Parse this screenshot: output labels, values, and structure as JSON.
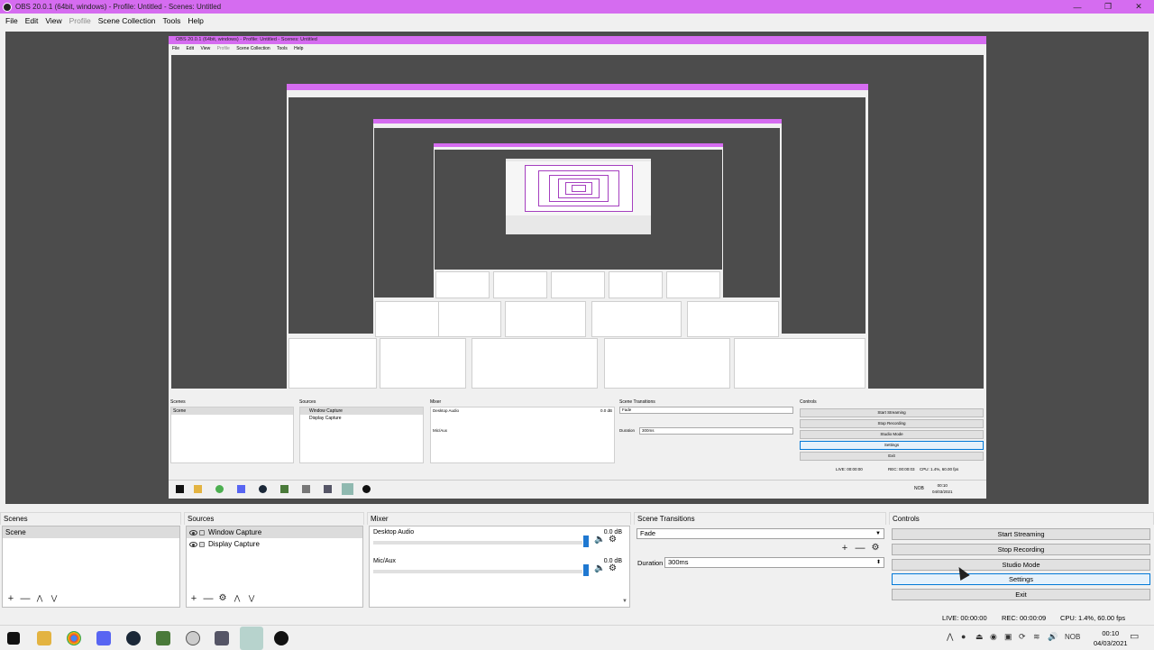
{
  "window": {
    "title": "OBS 20.0.1 (64bit, windows) - Profile: Untitled - Scenes: Untitled",
    "minimize": "—",
    "maximize": "❐",
    "close": "✕"
  },
  "menu": {
    "file": "File",
    "edit": "Edit",
    "view": "View",
    "profile": "Profile",
    "scene_collection": "Scene Collection",
    "tools": "Tools",
    "help": "Help"
  },
  "nested": {
    "title": "OBS 20.0.1 (64bit, windows) - Profile: Untitled - Scenes: Untitled",
    "menu": {
      "file": "File",
      "edit": "Edit",
      "view": "View",
      "profile": "Profile",
      "scene_collection": "Scene Collection",
      "tools": "Tools",
      "help": "Help"
    },
    "docks": {
      "scenes": "Scenes",
      "sources": "Sources",
      "mixer": "Mixer",
      "transitions": "Scene Transitions",
      "controls": "Controls"
    },
    "scene_item": "Scene",
    "sources": [
      "Window Capture",
      "Display Capture"
    ],
    "desktop_audio": "Desktop Audio",
    "mic_aux": "Mic/Aux",
    "db": "0.0 dB",
    "fade": "Fade",
    "duration_label": "Duration",
    "duration_value": "300ms",
    "buttons": [
      "Start Streaming",
      "Stop Recording",
      "Studio Mode",
      "Settings",
      "Exit"
    ],
    "live": "LIVE: 00:00:00",
    "rec": "REC: 00:00:03",
    "cpu": "CPU: 1.4%, 60.00 fps",
    "time": "00:10",
    "date": "04/03/2021",
    "lang": "NOB"
  },
  "docks": {
    "scenes": {
      "title": "Scenes",
      "items": [
        "Scene"
      ]
    },
    "sources": {
      "title": "Sources",
      "items": [
        "Window Capture",
        "Display Capture"
      ]
    },
    "mixer": {
      "title": "Mixer",
      "tracks": [
        {
          "name": "Desktop Audio",
          "level": "0.0 dB"
        },
        {
          "name": "Mic/Aux",
          "level": "0.0 dB"
        }
      ]
    },
    "transitions": {
      "title": "Scene Transitions",
      "selected": "Fade",
      "duration_label": "Duration",
      "duration_value": "300ms"
    },
    "controls": {
      "title": "Controls",
      "start_streaming": "Start Streaming",
      "stop_recording": "Stop Recording",
      "studio_mode": "Studio Mode",
      "settings": "Settings",
      "exit": "Exit"
    }
  },
  "status": {
    "live": "LIVE: 00:00:00",
    "rec": "REC: 00:00:09",
    "cpu": "CPU: 1.4%, 60.00 fps"
  },
  "taskbar": {
    "time": "00:10",
    "date": "04/03/2021",
    "lang": "NOB"
  },
  "icons": {
    "tool_add": "+",
    "tool_remove": "—",
    "tool_up": "⋀",
    "tool_down": "⋁",
    "tool_gear": "⚙"
  },
  "colors": {
    "title_bar": "#d56cf0",
    "preview_bg": "#4c4c4c",
    "slider": "#1f78d1",
    "mute": "#c00000"
  }
}
